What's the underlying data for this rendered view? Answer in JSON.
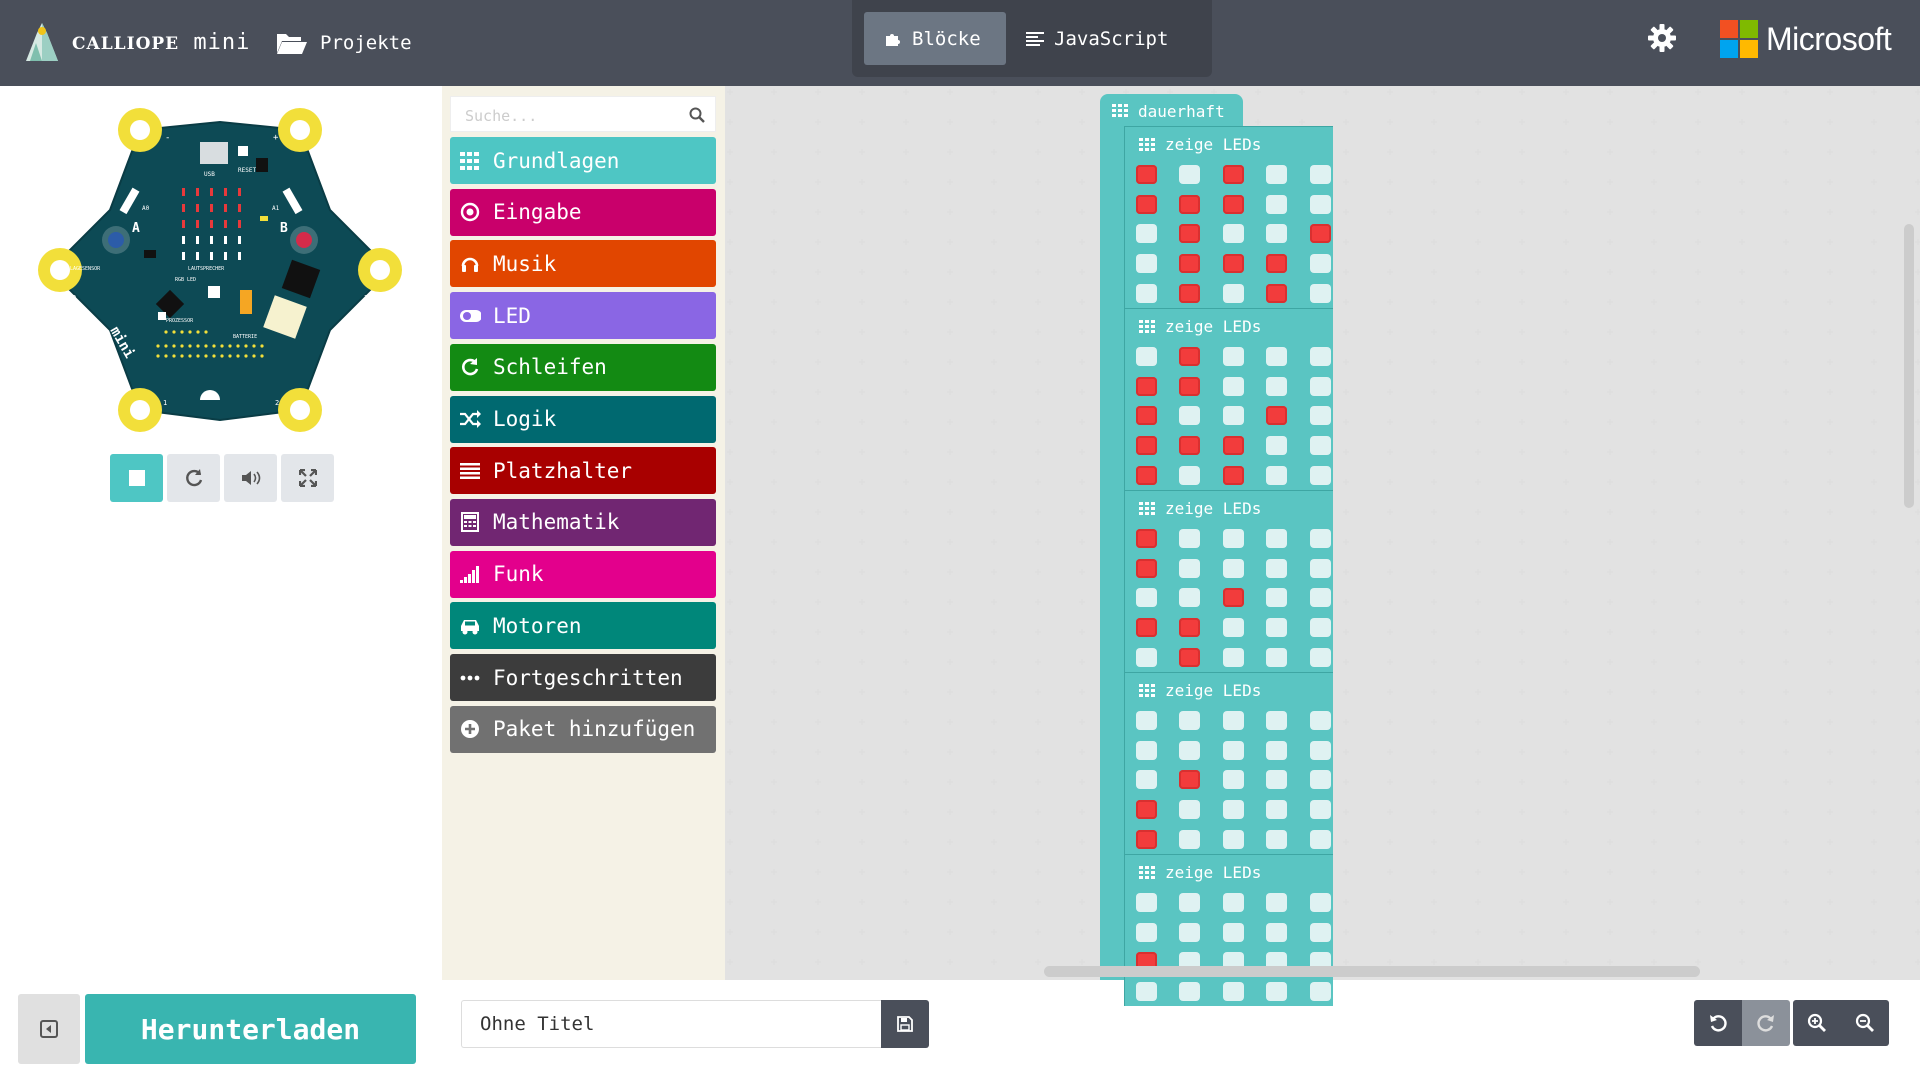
{
  "header": {
    "brand_small": "CALLIOPE",
    "brand_big": "mini",
    "projects_label": "Projekte",
    "tabs": [
      {
        "label": "Blöcke",
        "icon": "puzzle-icon",
        "active": true
      },
      {
        "label": "JavaScript",
        "icon": "code-lines-icon",
        "active": false
      }
    ],
    "microsoft_label": "Microsoft",
    "microsoft_colors": [
      "#f25022",
      "#7fba00",
      "#00a4ef",
      "#ffb900"
    ]
  },
  "simulator": {
    "board_labels": {
      "usb": "USB",
      "reset": "RESET",
      "a0": "A0",
      "a1": "A1",
      "button_a": "A",
      "button_b": "B",
      "lagesensor": "LAGESENSOR",
      "lautsprecher": "LAUTSPRECHER",
      "rgb_led": "RGB LED",
      "prozessor": "PROZESSOR",
      "batterie": "BATTERIE",
      "logo": "mini",
      "pin_minus": "-",
      "pin_plus": "+",
      "pin_0": "0",
      "pin_1": "1",
      "pin_2": "2",
      "pin_3": "3"
    },
    "controls": [
      {
        "name": "stop-icon",
        "active": true
      },
      {
        "name": "restart-icon",
        "active": false
      },
      {
        "name": "sound-icon",
        "active": false
      },
      {
        "name": "fullscreen-icon",
        "active": false
      }
    ]
  },
  "toolbox": {
    "search_placeholder": "Suche...",
    "categories": [
      {
        "label": "Grundlagen",
        "color": "#4ec6c4",
        "icon": "grid-icon"
      },
      {
        "label": "Eingabe",
        "color": "#c9006b",
        "icon": "radio-circle-icon"
      },
      {
        "label": "Musik",
        "color": "#e14600",
        "icon": "headphones-icon"
      },
      {
        "label": "LED",
        "color": "#8a66e4",
        "icon": "toggle-icon"
      },
      {
        "label": "Schleifen",
        "color": "#138a13",
        "icon": "refresh-icon"
      },
      {
        "label": "Logik",
        "color": "#006970",
        "icon": "shuffle-icon"
      },
      {
        "label": "Platzhalter",
        "color": "#a80000",
        "icon": "list-lines-icon"
      },
      {
        "label": "Mathematik",
        "color": "#712672",
        "icon": "calculator-icon"
      },
      {
        "label": "Funk",
        "color": "#e3008c",
        "icon": "signal-bars-icon"
      },
      {
        "label": "Motoren",
        "color": "#00877a",
        "icon": "car-icon"
      },
      {
        "label": "Fortgeschritten",
        "color": "#3c3c3c",
        "icon": "more-dots-icon"
      },
      {
        "label": "Paket hinzufügen",
        "color": "#717171",
        "icon": "plus-circle-icon"
      }
    ]
  },
  "workspace": {
    "forever_label": "dauerhaft",
    "show_leds_label": "zeige LEDs",
    "blocks": [
      {
        "leds": [
          [
            1,
            0,
            1,
            0,
            0
          ],
          [
            1,
            1,
            1,
            0,
            0
          ],
          [
            0,
            1,
            0,
            0,
            1
          ],
          [
            0,
            1,
            1,
            1,
            0
          ],
          [
            0,
            1,
            0,
            1,
            0
          ]
        ]
      },
      {
        "leds": [
          [
            0,
            1,
            0,
            0,
            0
          ],
          [
            1,
            1,
            0,
            0,
            0
          ],
          [
            1,
            0,
            0,
            1,
            0
          ],
          [
            1,
            1,
            1,
            0,
            0
          ],
          [
            1,
            0,
            1,
            0,
            0
          ]
        ]
      },
      {
        "leds": [
          [
            1,
            0,
            0,
            0,
            0
          ],
          [
            1,
            0,
            0,
            0,
            0
          ],
          [
            0,
            0,
            1,
            0,
            0
          ],
          [
            1,
            1,
            0,
            0,
            0
          ],
          [
            0,
            1,
            0,
            0,
            0
          ]
        ]
      },
      {
        "leds": [
          [
            0,
            0,
            0,
            0,
            0
          ],
          [
            0,
            0,
            0,
            0,
            0
          ],
          [
            0,
            1,
            0,
            0,
            0
          ],
          [
            1,
            0,
            0,
            0,
            0
          ],
          [
            1,
            0,
            0,
            0,
            0
          ]
        ]
      },
      {
        "leds": [
          [
            0,
            0,
            0,
            0,
            0
          ],
          [
            0,
            0,
            0,
            0,
            0
          ],
          [
            1,
            0,
            0,
            0,
            0
          ],
          [
            0,
            0,
            0,
            0,
            0
          ],
          [
            0,
            0,
            0,
            0,
            0
          ]
        ]
      }
    ]
  },
  "footer": {
    "download_label": "Herunterladen",
    "project_title_value": "Ohne Titel",
    "zoom_buttons": [
      {
        "name": "undo-icon",
        "disabled": false
      },
      {
        "name": "redo-icon",
        "disabled": true
      },
      {
        "name": "zoom-in-icon",
        "disabled": false
      },
      {
        "name": "zoom-out-icon",
        "disabled": false
      }
    ]
  }
}
